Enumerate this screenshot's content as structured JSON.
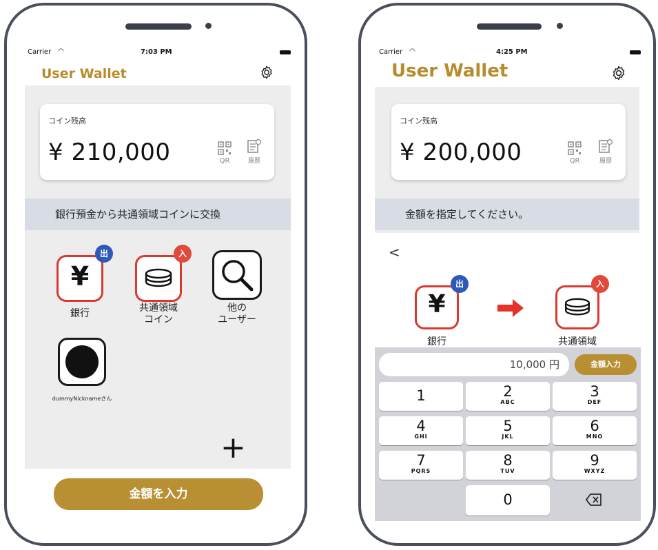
{
  "phone1": {
    "status": {
      "carrier": "Carrier",
      "time": "7:03 PM"
    },
    "title": "User Wallet",
    "card": {
      "label": "コイン残高",
      "amount": "¥ 210,000",
      "qr_label": "QR",
      "history_label": "履歴"
    },
    "banner": "銀行預金から共通領域コインに交換",
    "tiles": [
      {
        "symbol": "¥",
        "badge": "出",
        "label": "銀行"
      },
      {
        "badge": "入",
        "label_line1": "共通領域",
        "label_line2": "コイン"
      },
      {
        "label_line1": "他の",
        "label_line2": "ユーザー"
      },
      {
        "label": "dummyNicknameさん"
      }
    ],
    "add_symbol": "+",
    "enter_amount_button": "金額を入力"
  },
  "phone2": {
    "status": {
      "carrier": "Carrier",
      "time": "4:25 PM"
    },
    "title": "User Wallet",
    "card": {
      "label": "コイン残高",
      "amount": "¥ 200,000",
      "qr_label": "QR",
      "history_label": "履歴"
    },
    "banner": "金額を指定してください。",
    "back": "<",
    "from": {
      "symbol": "¥",
      "badge": "出",
      "label": "銀行"
    },
    "to": {
      "badge": "入",
      "label": "共通領域"
    },
    "amount_field": "10,000 円",
    "amount_button": "金額入力",
    "keys": [
      {
        "num": "1",
        "letters": ""
      },
      {
        "num": "2",
        "letters": "ABC"
      },
      {
        "num": "3",
        "letters": "DEF"
      },
      {
        "num": "4",
        "letters": "GHI"
      },
      {
        "num": "5",
        "letters": "JKL"
      },
      {
        "num": "6",
        "letters": "MNO"
      },
      {
        "num": "7",
        "letters": "PQRS"
      },
      {
        "num": "8",
        "letters": "TUV"
      },
      {
        "num": "9",
        "letters": "WXYZ"
      },
      {
        "num": "0",
        "letters": ""
      }
    ]
  },
  "colors": {
    "gold": "#b98f34",
    "red": "#d9392e",
    "blue": "#2e59b8",
    "frame": "#4a4f5c"
  }
}
